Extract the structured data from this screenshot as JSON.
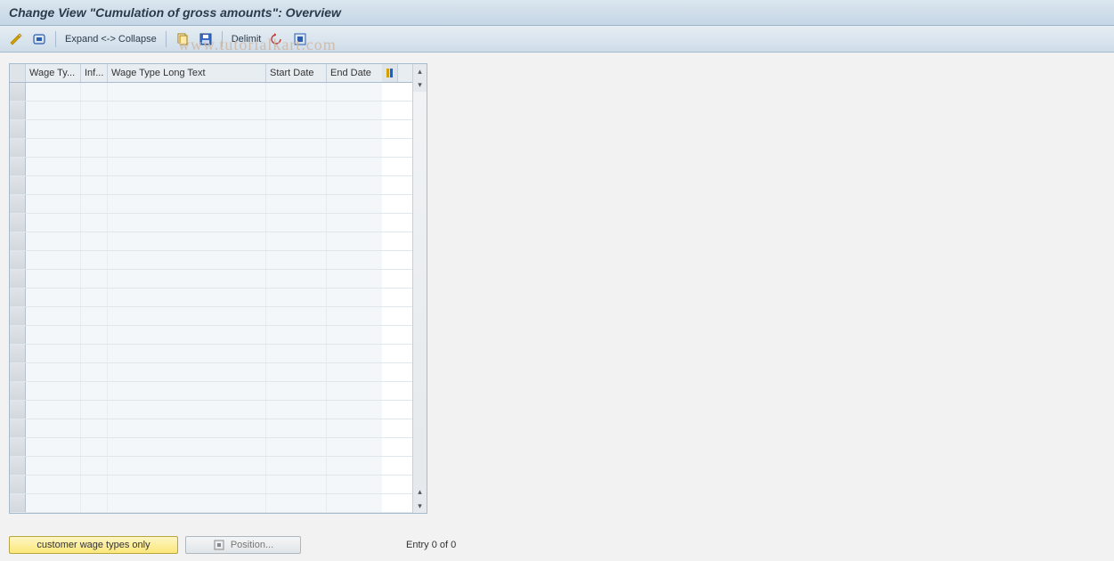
{
  "header": {
    "title": "Change View \"Cumulation of gross amounts\": Overview"
  },
  "toolbar": {
    "expand_collapse_label": "Expand <-> Collapse",
    "delimit_label": "Delimit"
  },
  "watermark": "www.tutorialkart.com",
  "table": {
    "columns": {
      "wage_type": "Wage Ty...",
      "inf": "Inf...",
      "wage_type_long_text": "Wage Type Long Text",
      "start_date": "Start Date",
      "end_date": "End Date"
    },
    "row_count": 23
  },
  "footer": {
    "customer_wage_types_label": "customer wage types only",
    "position_label": "Position...",
    "entry_text": "Entry 0 of 0"
  }
}
